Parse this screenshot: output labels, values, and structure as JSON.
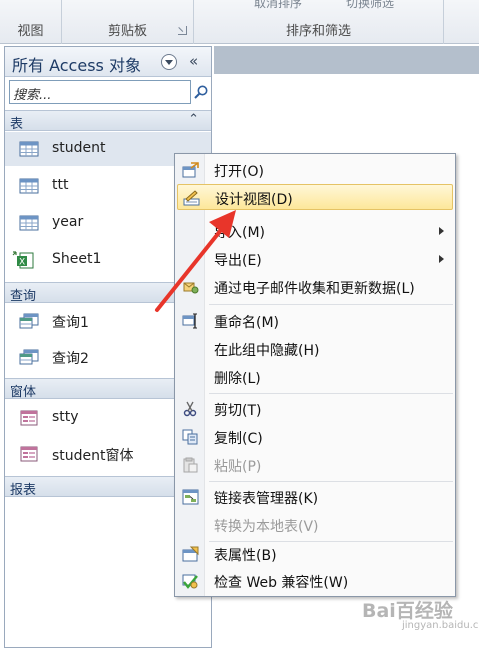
{
  "ribbon": {
    "groups": [
      {
        "label": "视图"
      },
      {
        "label": "剪贴板"
      },
      {
        "label": "排序和筛选",
        "top_items": [
          "取消排序",
          "切换筛选"
        ]
      }
    ]
  },
  "nav_pane": {
    "title": "所有 Access 对象",
    "collapse_glyph": "«",
    "search_placeholder": "搜索...",
    "groups": [
      {
        "label": "表",
        "items": [
          {
            "label": "student",
            "icon": "table-icon",
            "selected": true
          },
          {
            "label": "ttt",
            "icon": "table-icon"
          },
          {
            "label": "year",
            "icon": "table-icon"
          },
          {
            "label": "Sheet1",
            "icon": "excel-linked-table-icon"
          }
        ]
      },
      {
        "label": "查询",
        "items": [
          {
            "label": "查询1",
            "icon": "query-icon"
          },
          {
            "label": "查询2",
            "icon": "query-icon"
          }
        ]
      },
      {
        "label": "窗体",
        "items": [
          {
            "label": "stty",
            "icon": "form-icon"
          },
          {
            "label": "student窗体",
            "icon": "form-icon"
          }
        ]
      },
      {
        "label": "报表",
        "items": []
      }
    ]
  },
  "context_menu": {
    "items": [
      {
        "label": "打开(O)",
        "icon": "open-icon"
      },
      {
        "label": "设计视图(D)",
        "icon": "design-view-icon",
        "highlighted": true
      },
      {
        "label": "导入(M)",
        "submenu": true
      },
      {
        "label": "导出(E)",
        "submenu": true
      },
      {
        "label": "通过电子邮件收集和更新数据(L)",
        "icon": "email-collect-icon"
      },
      {
        "label": "重命名(M)",
        "icon": "rename-icon"
      },
      {
        "label": "在此组中隐藏(H)"
      },
      {
        "label": "删除(L)"
      },
      {
        "label": "剪切(T)",
        "icon": "cut-icon"
      },
      {
        "label": "复制(C)",
        "icon": "copy-icon"
      },
      {
        "label": "粘贴(P)",
        "icon": "paste-icon",
        "disabled": true
      },
      {
        "label": "链接表管理器(K)",
        "icon": "linked-table-manager-icon"
      },
      {
        "label": "转换为本地表(V)",
        "disabled": true
      },
      {
        "label": "表属性(B)",
        "icon": "table-properties-icon"
      },
      {
        "label": "检查 Web 兼容性(W)",
        "icon": "web-compat-icon"
      }
    ]
  },
  "annotation": {
    "color": "#e8352a"
  },
  "watermark": {
    "text": "Bai百经验",
    "sub": "jingyan.baidu.com"
  }
}
